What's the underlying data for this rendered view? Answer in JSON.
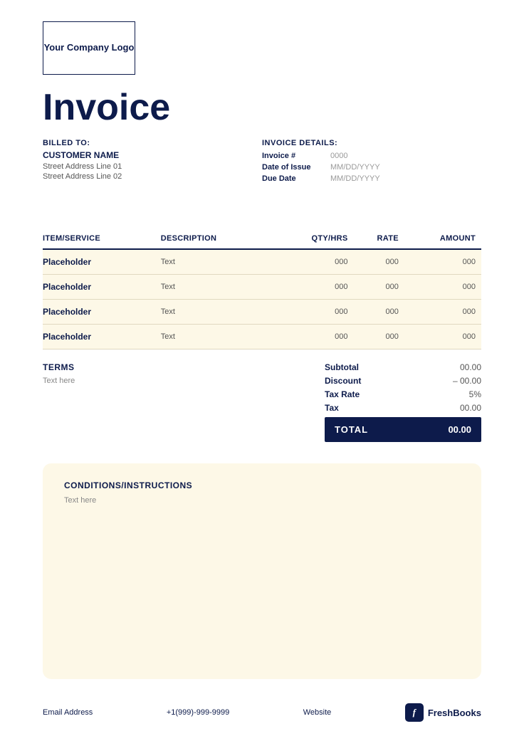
{
  "logo": {
    "text": "Your Company Logo"
  },
  "invoice": {
    "title": "Invoice"
  },
  "billing": {
    "label": "BILLED TO:",
    "customer_name": "CUSTOMER NAME",
    "address_line1": "Street Address Line 01",
    "address_line2": "Street Address Line 02"
  },
  "invoice_details": {
    "label": "INVOICE DETAILS:",
    "fields": [
      {
        "key": "Invoice #",
        "value": "0000"
      },
      {
        "key": "Date of Issue",
        "value": "MM/DD/YYYY"
      },
      {
        "key": "Due Date",
        "value": "MM/DD/YYYY"
      }
    ]
  },
  "table": {
    "headers": [
      "ITEM/SERVICE",
      "DESCRIPTION",
      "QTY/HRS",
      "RATE",
      "AMOUNT"
    ],
    "rows": [
      {
        "item": "Placeholder",
        "description": "Text",
        "qty": "000",
        "rate": "000",
        "amount": "000"
      },
      {
        "item": "Placeholder",
        "description": "Text",
        "qty": "000",
        "rate": "000",
        "amount": "000"
      },
      {
        "item": "Placeholder",
        "description": "Text",
        "qty": "000",
        "rate": "000",
        "amount": "000"
      },
      {
        "item": "Placeholder",
        "description": "Text",
        "qty": "000",
        "rate": "000",
        "amount": "000"
      }
    ]
  },
  "terms": {
    "title": "TERMS",
    "text": "Text here"
  },
  "totals": {
    "subtotal_label": "Subtotal",
    "subtotal_value": "00.00",
    "discount_label": "Discount",
    "discount_value": "– 00.00",
    "tax_rate_label": "Tax Rate",
    "tax_rate_value": "5%",
    "tax_label": "Tax",
    "tax_value": "00.00",
    "total_label": "TOTAL",
    "total_value": "00.00"
  },
  "conditions": {
    "title": "CONDITIONS/INSTRUCTIONS",
    "text": "Text here"
  },
  "footer": {
    "email": "Email Address",
    "phone": "+1(999)-999-9999",
    "website": "Website",
    "brand": "FreshBooks"
  }
}
